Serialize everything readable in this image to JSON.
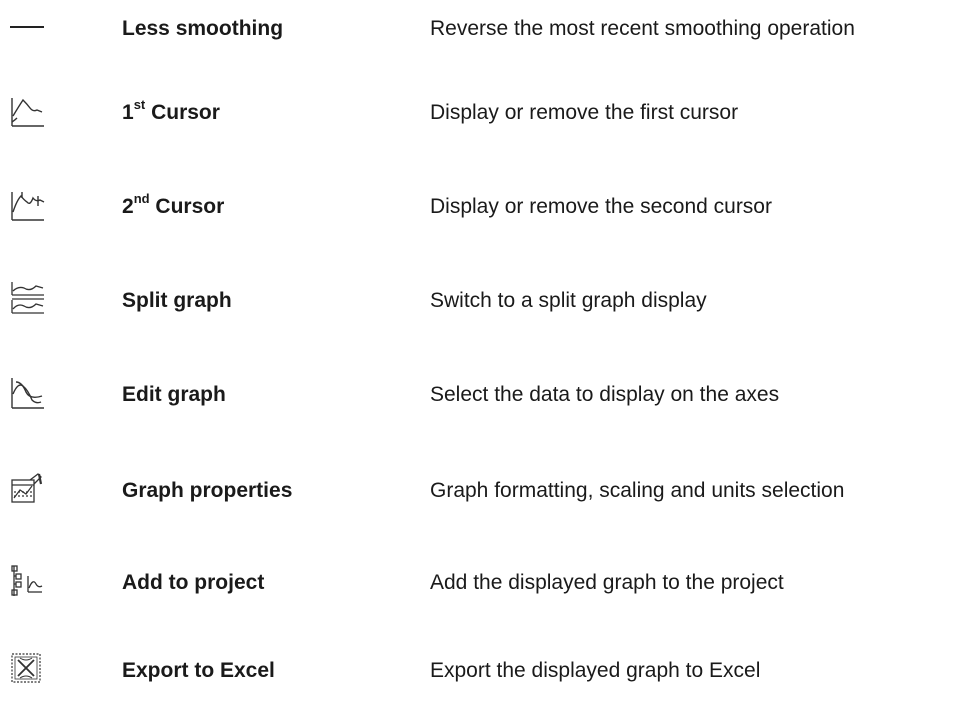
{
  "rows": [
    {
      "icon": "less-smoothing-icon",
      "name": "Less smoothing",
      "description": "Reverse the most recent smoothing operation"
    },
    {
      "icon": "first-cursor-icon",
      "name_prefix": "1",
      "name_sup": "st",
      "name_suffix": " Cursor",
      "description": "Display or remove the first cursor"
    },
    {
      "icon": "second-cursor-icon",
      "name_prefix": "2",
      "name_sup": "nd",
      "name_suffix": " Cursor",
      "description": "Display or remove the second cursor"
    },
    {
      "icon": "split-graph-icon",
      "name": "Split graph",
      "description": "Switch to a split graph display"
    },
    {
      "icon": "edit-graph-icon",
      "name": "Edit graph",
      "description": "Select the data to display on the axes"
    },
    {
      "icon": "graph-properties-icon",
      "name": "Graph properties",
      "description": "Graph formatting, scaling and units selection"
    },
    {
      "icon": "add-to-project-icon",
      "name": "Add to project",
      "description": "Add the displayed graph to the project"
    },
    {
      "icon": "export-to-excel-icon",
      "name": "Export to Excel",
      "description": "Export the displayed graph to Excel"
    }
  ]
}
